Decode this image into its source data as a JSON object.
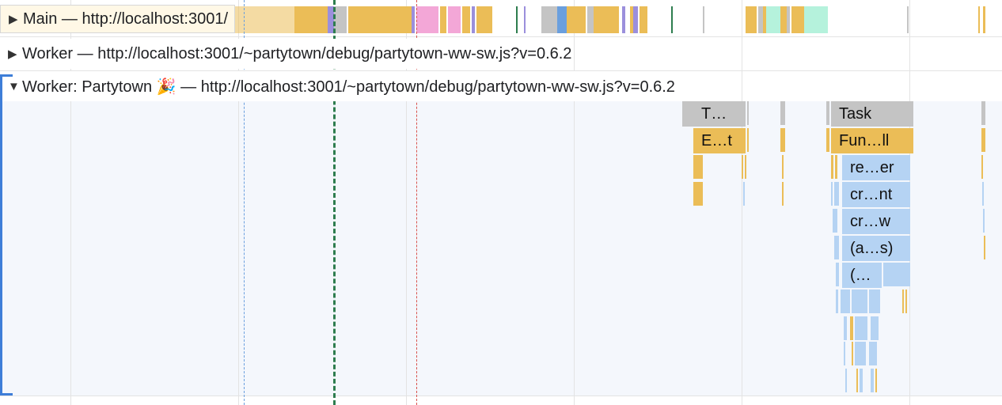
{
  "tracks": {
    "main": {
      "label": "Main — http://localhost:3001/",
      "expanded": false
    },
    "worker": {
      "label": "Worker — http://localhost:3001/~partytown/debug/partytown-ww-sw.js?v=0.6.2",
      "expanded": false
    },
    "partytown": {
      "label": "Worker: Partytown 🎉 — http://localhost:3001/~partytown/debug/partytown-ww-sw.js?v=0.6.2",
      "expanded": true
    }
  },
  "icons": {
    "collapsed": "triangle-right-icon",
    "expanded": "triangle-down-icon"
  },
  "flame": {
    "task_short": "T…",
    "task": "Task",
    "event_short": "E…t",
    "function_call": "Fun…ll",
    "re_er": "re…er",
    "cr_nt": "cr…nt",
    "cr_w": "cr…w",
    "anon_s": "(a…s)",
    "anon": "(…"
  },
  "colors": {
    "task_gray": "#c4c4c4",
    "scripting_yellow": "#ebbd57",
    "js_blue": "#b5d3f3",
    "rendering_purple": "#9b8fdc",
    "painting_pink": "#f3a7d7",
    "teal": "#b5f2dc",
    "marker_blue": "#6a9fde",
    "marker_green": "#2e7d4f",
    "marker_red": "#d9534f",
    "selection_blue": "#3e7ed8"
  }
}
